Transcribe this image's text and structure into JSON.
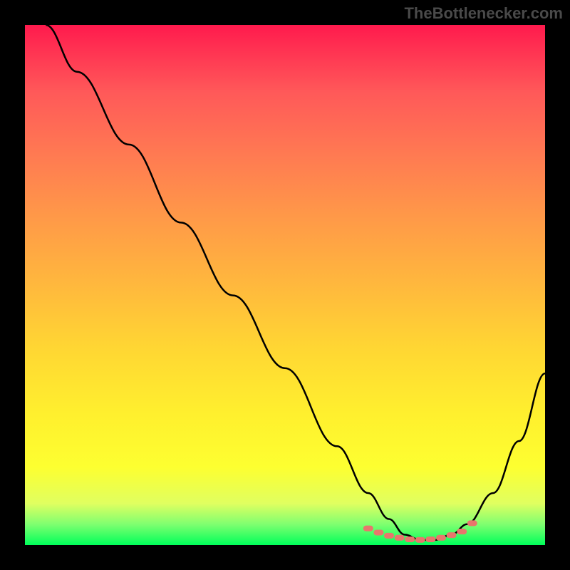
{
  "watermark": "TheBottlenecker.com",
  "chart_data": {
    "type": "line",
    "title": "",
    "xlabel": "",
    "ylabel": "",
    "xlim": [
      0,
      100
    ],
    "ylim": [
      0,
      100
    ],
    "series": [
      {
        "name": "curve",
        "x": [
          4,
          10,
          20,
          30,
          40,
          50,
          60,
          66,
          70,
          73,
          76,
          79,
          82,
          85,
          90,
          95,
          100
        ],
        "y": [
          100,
          91,
          77,
          62,
          48,
          34,
          19,
          10,
          5,
          2,
          1,
          1,
          2,
          4,
          10,
          20,
          33
        ]
      }
    ],
    "markers": {
      "name": "highlight-region",
      "x": [
        66,
        68,
        70,
        72,
        74,
        76,
        78,
        80,
        82,
        84,
        86
      ],
      "y": [
        3.2,
        2.4,
        1.8,
        1.4,
        1.1,
        1.0,
        1.1,
        1.4,
        1.9,
        2.6,
        4.2
      ],
      "color": "#e8766c"
    },
    "background_gradient": {
      "type": "vertical",
      "stops": [
        {
          "pos": 0,
          "color": "#ff1a4d"
        },
        {
          "pos": 50,
          "color": "#ffb83d"
        },
        {
          "pos": 85,
          "color": "#fdff30"
        },
        {
          "pos": 100,
          "color": "#00ff5a"
        }
      ]
    }
  }
}
